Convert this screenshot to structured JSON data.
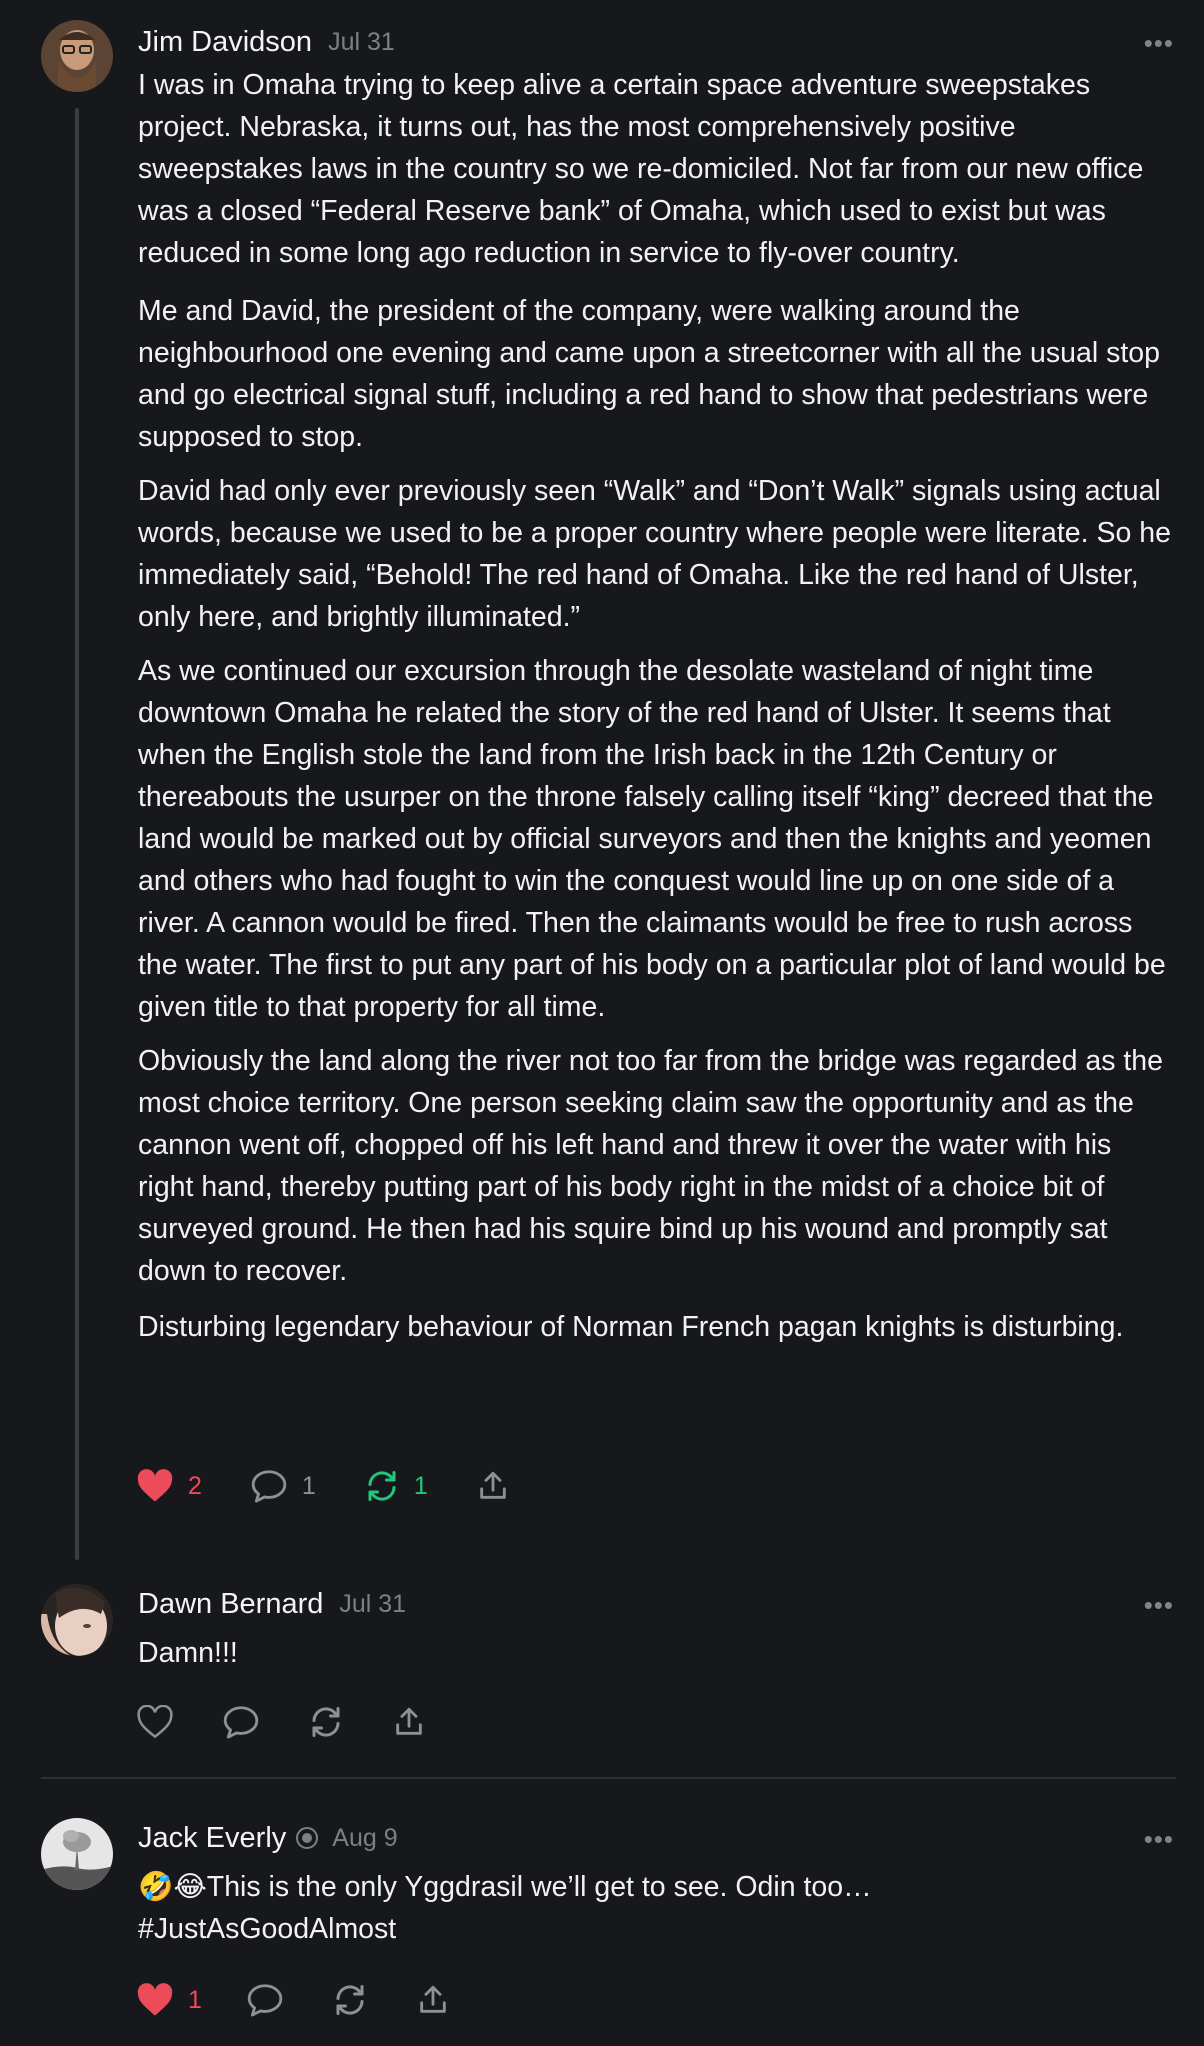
{
  "posts": [
    {
      "author": "Jim Davidson",
      "date": "Jul 31",
      "paragraphs": [
        "I was in Omaha trying to keep alive a certain space adventure sweepstakes project. Nebraska, it turns out, has the most comprehensively positive sweepstakes laws in the country so we re-domiciled. Not far from our new office was a closed “Federal Reserve bank” of Omaha, which used to exist but was reduced in some long ago reduction in service to fly-over country.",
        "Me and David, the president of the company, were walking around the neighbourhood one evening and came upon a streetcorner with all the usual stop and go electrical signal stuff, including a red hand to show that pedestrians were supposed to stop.",
        "David had only ever previously seen “Walk” and “Don’t Walk” signals using actual words, because we used to be a proper country where people were literate. So he immediately said, “Behold! The red hand of Omaha. Like the red hand of Ulster, only here, and brightly illuminated.”",
        "As we continued our excursion through the desolate wasteland of night time downtown Omaha he related the story of the red hand of Ulster. It seems that when the English stole the land from the Irish back in the 12th Century or thereabouts the usurper on the throne falsely calling itself “king” decreed that the land would be marked out by official surveyors and then the knights and yeomen and others who had fought to win the conquest would line up on one side of a river. A cannon would be fired. Then the claimants would be free to rush across the water. The first to put any part of his body on a particular plot of land would be given title to that property for all time.",
        "Obviously the land along the river not too far from the bridge was regarded as the most choice territory. One person seeking claim saw the opportunity and as the cannon went off, chopped off his left hand and threw it over the water with his right hand, thereby putting part of his body right in the midst of a choice bit of surveyed ground. He then had his squire bind up his wound and promptly sat down to recover.",
        "Disturbing legendary behaviour of Norman French pagan knights is disturbing."
      ],
      "likes": "2",
      "replies": "1",
      "reposts": "1"
    },
    {
      "author": "Dawn Bernard",
      "date": "Jul 31",
      "text": "Damn!!!"
    },
    {
      "author": "Jack Everly",
      "date": "Aug 9",
      "text": "🤣😂This is the only Yggdrasil we’ll get to see. Odin too… #JustAsGoodAlmost",
      "likes": "1"
    }
  ],
  "more_label": "•••",
  "colors": {
    "background": "#16181c",
    "like_active": "#ec4b5a",
    "repost_active": "#21c77a",
    "icon_muted": "#8d9096"
  }
}
